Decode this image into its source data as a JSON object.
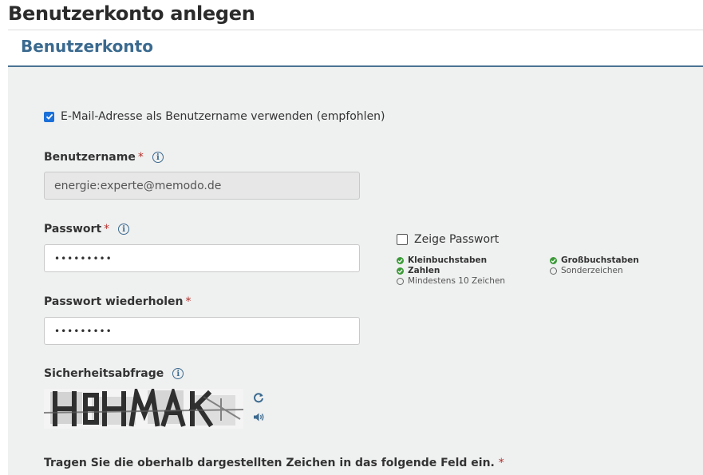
{
  "page": {
    "title": "Benutzerkonto anlegen"
  },
  "section": {
    "title": "Benutzerkonto"
  },
  "email_as_username": {
    "label": "E-Mail-Adresse als Benutzername verwenden (empfohlen)",
    "checked": true
  },
  "username": {
    "label": "Benutzername",
    "required_mark": "*",
    "value": "energie:experte@memodo.de",
    "icon": "info-icon"
  },
  "password": {
    "label": "Passwort",
    "required_mark": "*",
    "value": "•••••••••",
    "icon": "info-icon"
  },
  "show_password": {
    "label": "Zeige Passwort",
    "checked": false
  },
  "password_rules": [
    {
      "label": "Kleinbuchstaben",
      "met": true
    },
    {
      "label": "Zahlen",
      "met": true
    },
    {
      "label": "Mindestens 10 Zeichen",
      "met": false
    },
    {
      "label": "Großbuchstaben",
      "met": true
    },
    {
      "label": "Sonderzeichen",
      "met": false
    }
  ],
  "password_repeat": {
    "label": "Passwort wiederholen",
    "required_mark": "*",
    "value": "•••••••••"
  },
  "captcha": {
    "label": "Sicherheitsabfrage",
    "icon": "info-icon",
    "image_text": "H8HMAK",
    "refresh_icon": "refresh-icon",
    "audio_icon": "speaker-icon"
  },
  "captcha_input": {
    "label": "Tragen Sie die oberhalb dargestellten Zeichen in das folgende Feld ein.",
    "required_mark": "*"
  },
  "colors": {
    "accent": "#3b6a8f",
    "checkbox": "#1a6fd8",
    "required": "#b5312c",
    "success": "#3c9a38",
    "panel": "#eff0f0"
  }
}
